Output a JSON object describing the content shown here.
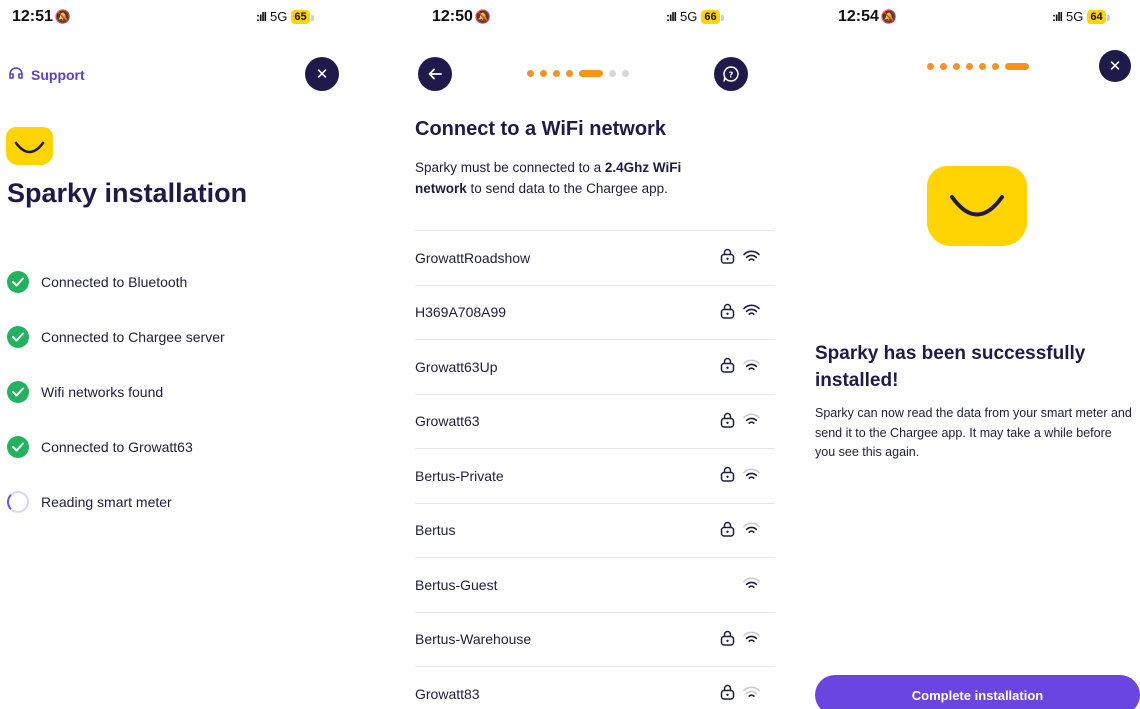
{
  "screens": [
    {
      "status": {
        "time": "12:51",
        "network": "5G",
        "battery": "65"
      },
      "support_label": "Support",
      "title": "Sparky installation",
      "steps": [
        {
          "label": "Connected to Bluetooth",
          "state": "done"
        },
        {
          "label": "Connected to Chargee server",
          "state": "done"
        },
        {
          "label": "Wifi networks found",
          "state": "done"
        },
        {
          "label": "Connected to Growatt63",
          "state": "done"
        },
        {
          "label": "Reading smart meter",
          "state": "loading"
        }
      ]
    },
    {
      "status": {
        "time": "12:50",
        "network": "5G",
        "battery": "66"
      },
      "progress": {
        "current_step": 5,
        "total_steps": 7
      },
      "title": "Connect to a WiFi network",
      "description_pre": "Sparky must be connected to a ",
      "description_bold": "2.4Ghz WiFi network",
      "description_post": " to send data to the Chargee app.",
      "networks": [
        {
          "ssid": "GrowattRoadshow",
          "locked": true,
          "strength": 3
        },
        {
          "ssid": "H369A708A99",
          "locked": true,
          "strength": 3
        },
        {
          "ssid": "Growatt63Up",
          "locked": true,
          "strength": 2
        },
        {
          "ssid": "Growatt63",
          "locked": true,
          "strength": 2
        },
        {
          "ssid": "Bertus-Private",
          "locked": true,
          "strength": 2
        },
        {
          "ssid": "Bertus",
          "locked": true,
          "strength": 2
        },
        {
          "ssid": "Bertus-Guest",
          "locked": false,
          "strength": 2
        },
        {
          "ssid": "Bertus-Warehouse",
          "locked": true,
          "strength": 2
        },
        {
          "ssid": "Growatt83",
          "locked": true,
          "strength": 1
        }
      ]
    },
    {
      "status": {
        "time": "12:54",
        "network": "5G",
        "battery": "64"
      },
      "progress": {
        "current_step": 7,
        "total_steps": 7
      },
      "title": "Sparky has been successfully installed!",
      "description": "Sparky can now read the data from your smart meter and send it to the Chargee app. It may take a while before you see this again.",
      "button_label": "Complete installation"
    }
  ],
  "colors": {
    "accent": "#6a45e0",
    "dark": "#1e1b4b",
    "brand_yellow": "#ffd400",
    "progress_orange": "#f7931e",
    "success_green": "#22b35e"
  },
  "icons": [
    "bell-muted-icon",
    "signal-icon",
    "support-headset-icon",
    "close-icon",
    "back-arrow-icon",
    "help-chat-icon",
    "check-icon",
    "spinner-icon",
    "lock-icon",
    "wifi-icon",
    "smiley-logo-icon"
  ]
}
